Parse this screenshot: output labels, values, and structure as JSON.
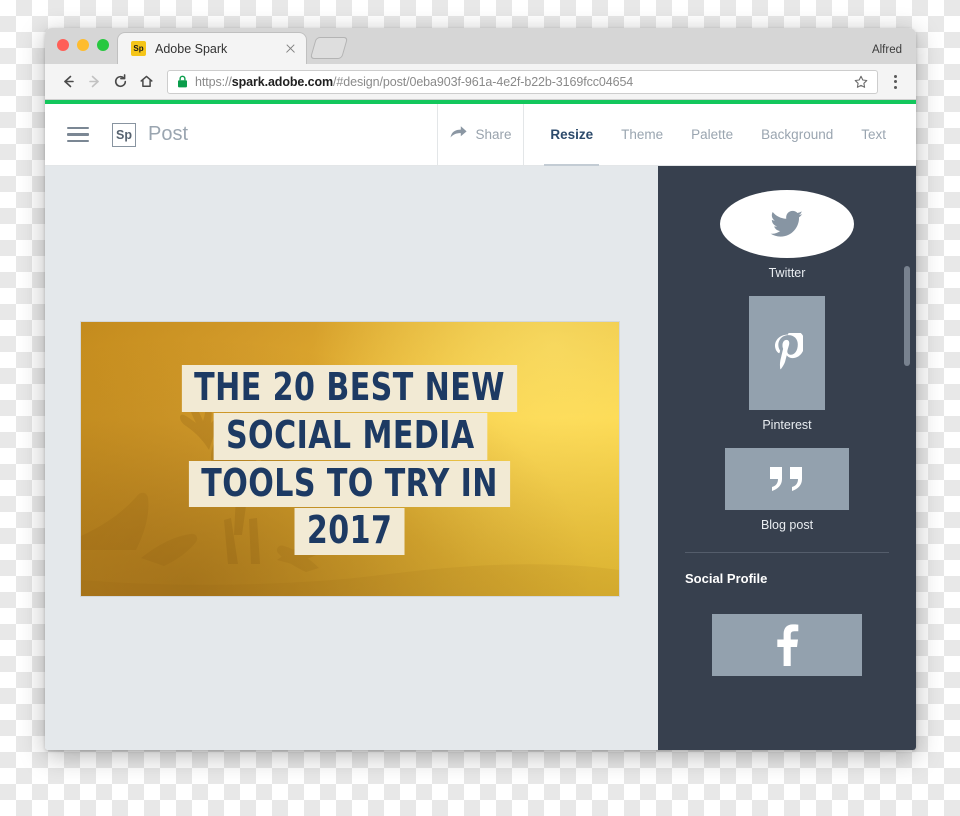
{
  "browser": {
    "profile_name": "Alfred",
    "tab": {
      "title": "Adobe Spark",
      "favicon_text": "Sp",
      "favicon_color": "#f5c518",
      "close_icon": "close-icon"
    },
    "toolbar": {
      "back_icon": "back-arrow-icon",
      "forward_icon": "forward-arrow-icon",
      "reload_icon": "reload-icon",
      "home_icon": "home-icon",
      "lock_icon": "lock-icon",
      "star_icon": "star-icon",
      "menu_icon": "three-dot-menu-icon",
      "url_scheme": "https://",
      "url_domain": "spark.adobe.com",
      "url_path": "/#design/post/0eba903f-961a-4e2f-b22b-3169fcc04654",
      "url_full": "https://spark.adobe.com/#design/post/0eba903f-961a-4e2f-b22b-3169fcc04654"
    },
    "loading_bar_color": "#13c75c"
  },
  "app": {
    "menu_icon": "hamburger-menu-icon",
    "logo_text": "Sp",
    "document_title": "Post",
    "share": {
      "label": "Share",
      "icon": "share-arrow-icon"
    },
    "tabs": [
      {
        "label": "Resize",
        "active": true
      },
      {
        "label": "Theme",
        "active": false
      },
      {
        "label": "Palette",
        "active": false
      },
      {
        "label": "Background",
        "active": false
      },
      {
        "label": "Text",
        "active": false
      }
    ],
    "canvas_background": "#e4e8eb"
  },
  "artwork": {
    "lines": [
      "THE 20 BEST NEW",
      "SOCIAL MEDIA",
      "TOOLS TO TRY IN",
      "2017"
    ],
    "text_color": "#1d3a63",
    "highlight_color": "#f2ead4",
    "background_colors": [
      "#c9901f",
      "#e8b534",
      "#fcd740"
    ],
    "image_subject": "deer-silhouette-in-golden-mist"
  },
  "panel": {
    "background_color": "#37404e",
    "formats": [
      {
        "label": "Twitter",
        "icon": "twitter-bird-icon",
        "selected": true
      },
      {
        "label": "Pinterest",
        "icon": "pinterest-p-icon",
        "selected": false
      },
      {
        "label": "Blog post",
        "icon": "quote-marks-icon",
        "selected": false
      }
    ],
    "section_title": "Social Profile",
    "profile_formats": [
      {
        "label": "Facebook",
        "icon": "facebook-f-icon",
        "selected": false
      }
    ],
    "scrollbar": "vertical-scrollbar"
  }
}
